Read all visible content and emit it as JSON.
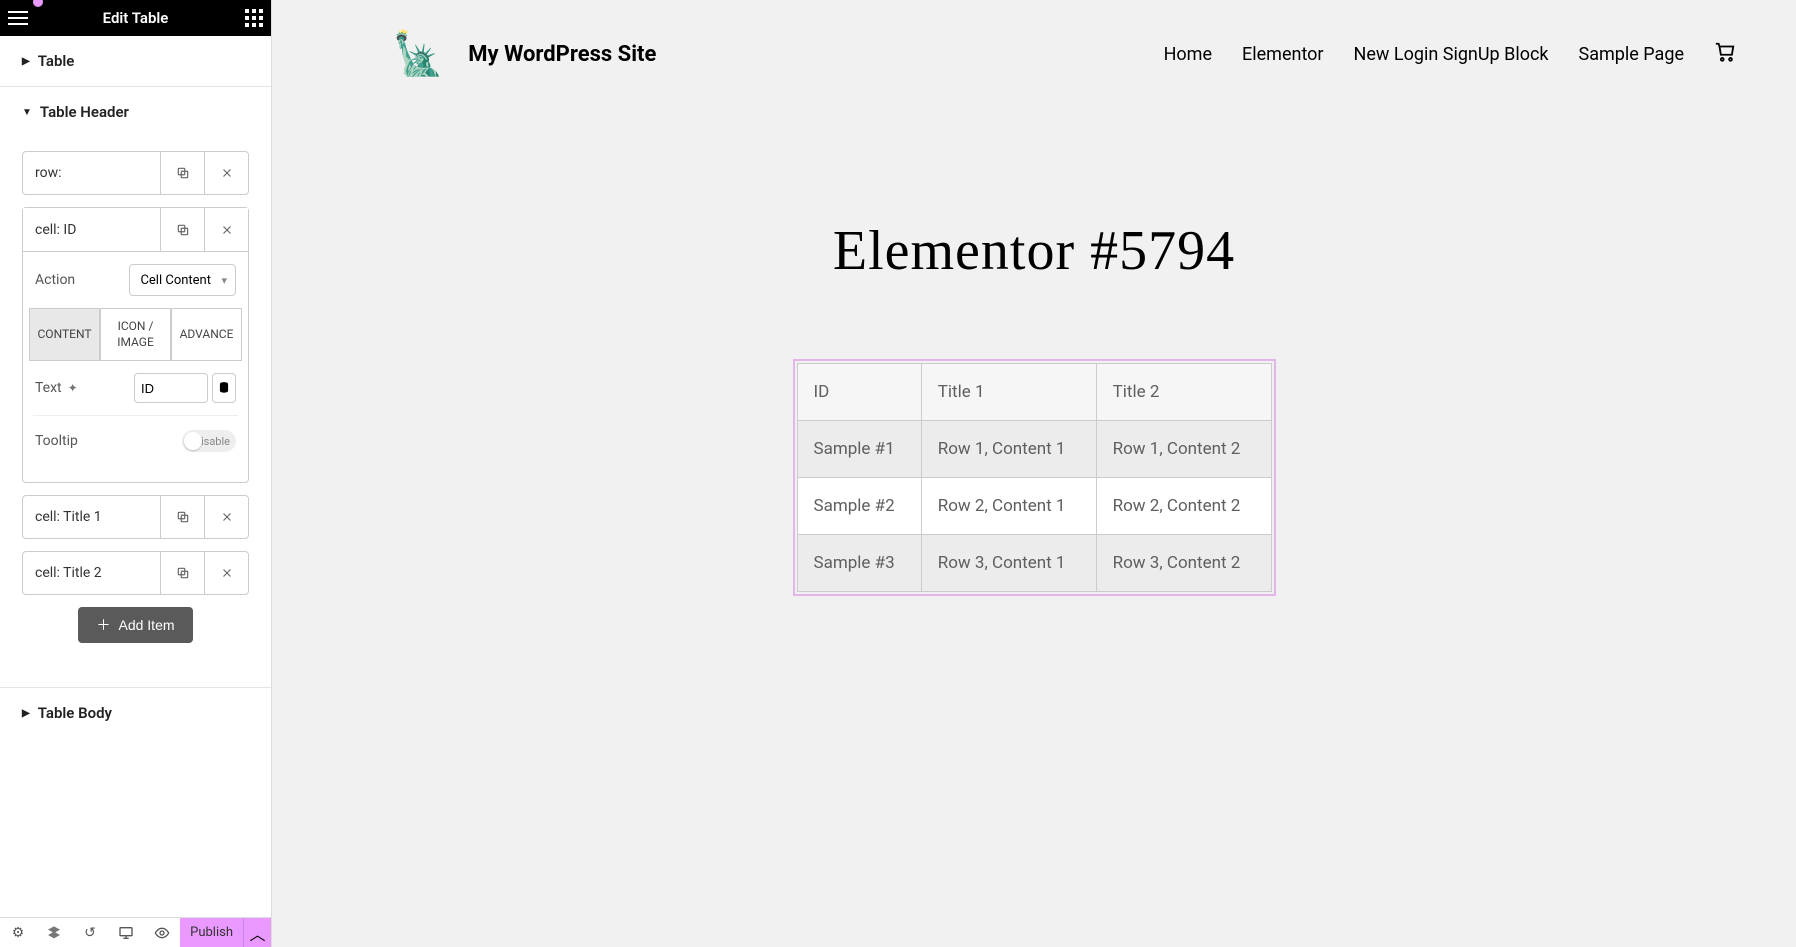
{
  "editor": {
    "title": "Edit Table",
    "sections": {
      "table": "Table",
      "table_header": "Table Header",
      "table_body": "Table Body"
    },
    "header_items": {
      "row_label": "row:",
      "cell_id_label": "cell: ID",
      "cell_title1_label": "cell: Title 1",
      "cell_title2_label": "cell: Title 2"
    },
    "cell_editor": {
      "action_label": "Action",
      "action_value": "Cell Content",
      "tab_content": "CONTENT",
      "tab_icon": "ICON / IMAGE",
      "tab_advance": "ADVANCE",
      "text_label": "Text",
      "text_value": "ID",
      "tooltip_label": "Tooltip",
      "tooltip_state": "Disable"
    },
    "add_item": "Add Item",
    "publish": "Publish"
  },
  "site": {
    "title": "My WordPress Site",
    "logo_emoji": "🗽",
    "nav": {
      "home": "Home",
      "elementor": "Elementor",
      "new_login": "New Login SignUp Block",
      "sample": "Sample Page"
    },
    "page_title": "Elementor #5794"
  },
  "table": {
    "headers": [
      "ID",
      "Title 1",
      "Title 2"
    ],
    "rows": [
      [
        "Sample #1",
        "Row 1, Content 1",
        "Row 1, Content 2"
      ],
      [
        "Sample #2",
        "Row 2, Content 1",
        "Row 2, Content 2"
      ],
      [
        "Sample #3",
        "Row 3, Content 1",
        "Row 3, Content 2"
      ]
    ]
  }
}
